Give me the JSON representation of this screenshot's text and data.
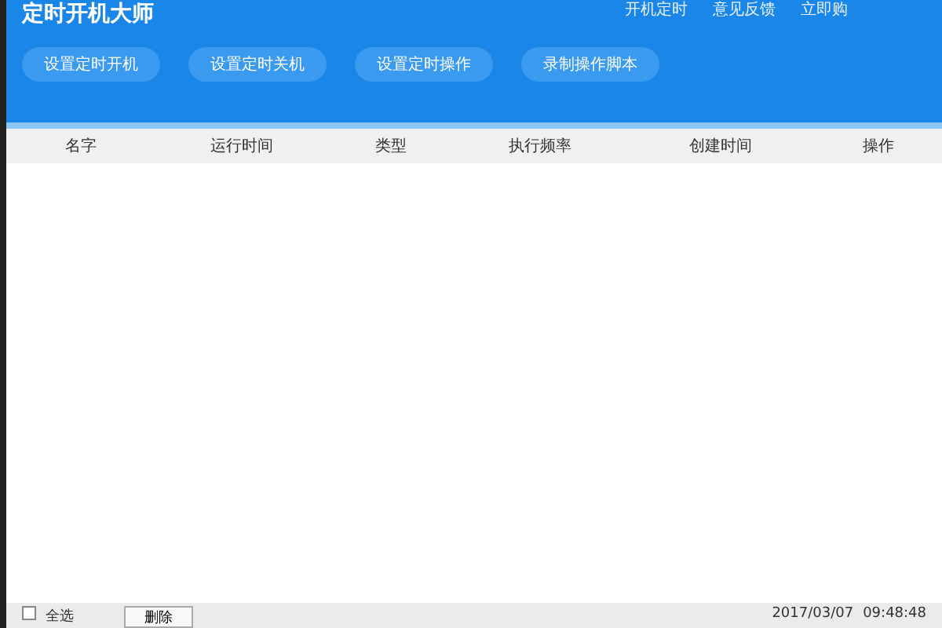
{
  "window": {
    "title": "定时开机大师"
  },
  "top_links": [
    "开机定时",
    "意见反馈",
    "立即购"
  ],
  "toolbar": [
    "设置定时开机",
    "设置定时关机",
    "设置定时操作",
    "录制操作脚本"
  ],
  "table": {
    "columns": [
      "名字",
      "运行时间",
      "类型",
      "执行频率",
      "创建时间",
      "操作"
    ]
  },
  "footer": {
    "select_all": {
      "label": "全选",
      "checked": false
    },
    "delete_button": "删除",
    "date": "2017/03/07",
    "time": "09:48:48"
  }
}
